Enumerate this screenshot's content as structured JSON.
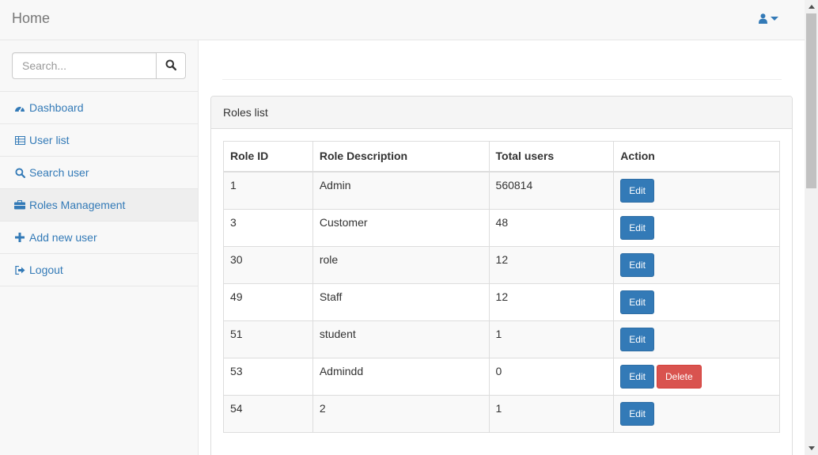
{
  "navbar": {
    "brand": "Home",
    "user_icon": "user-icon",
    "caret_icon": "caret-down-icon"
  },
  "sidebar": {
    "search": {
      "placeholder": "Search...",
      "value": "",
      "icon": "search-icon"
    },
    "items": [
      {
        "label": "Dashboard",
        "icon": "dashboard-icon",
        "active": false
      },
      {
        "label": "User list",
        "icon": "table-icon",
        "active": false
      },
      {
        "label": "Search user",
        "icon": "search-icon",
        "active": false
      },
      {
        "label": "Roles Management",
        "icon": "briefcase-icon",
        "active": true
      },
      {
        "label": "Add new user",
        "icon": "plus-icon",
        "active": false
      },
      {
        "label": "Logout",
        "icon": "logout-icon",
        "active": false
      }
    ]
  },
  "main": {
    "panel_title": "Roles list",
    "table": {
      "headers": [
        "Role ID",
        "Role Description",
        "Total users",
        "Action"
      ],
      "rows": [
        {
          "id": "1",
          "description": "Admin",
          "total": "560814",
          "actions": [
            "Edit"
          ]
        },
        {
          "id": "3",
          "description": "Customer",
          "total": "48",
          "actions": [
            "Edit"
          ]
        },
        {
          "id": "30",
          "description": "role",
          "total": "12",
          "actions": [
            "Edit"
          ]
        },
        {
          "id": "49",
          "description": "Staff",
          "total": "12",
          "actions": [
            "Edit"
          ]
        },
        {
          "id": "51",
          "description": "student",
          "total": "1",
          "actions": [
            "Edit"
          ]
        },
        {
          "id": "53",
          "description": "Admindd",
          "total": "0",
          "actions": [
            "Edit",
            "Delete"
          ]
        },
        {
          "id": "54",
          "description": "2",
          "total": "1",
          "actions": [
            "Edit"
          ]
        }
      ]
    }
  },
  "colors": {
    "link": "#337ab7",
    "primary_button": "#337ab7",
    "danger_button": "#d9534f"
  }
}
